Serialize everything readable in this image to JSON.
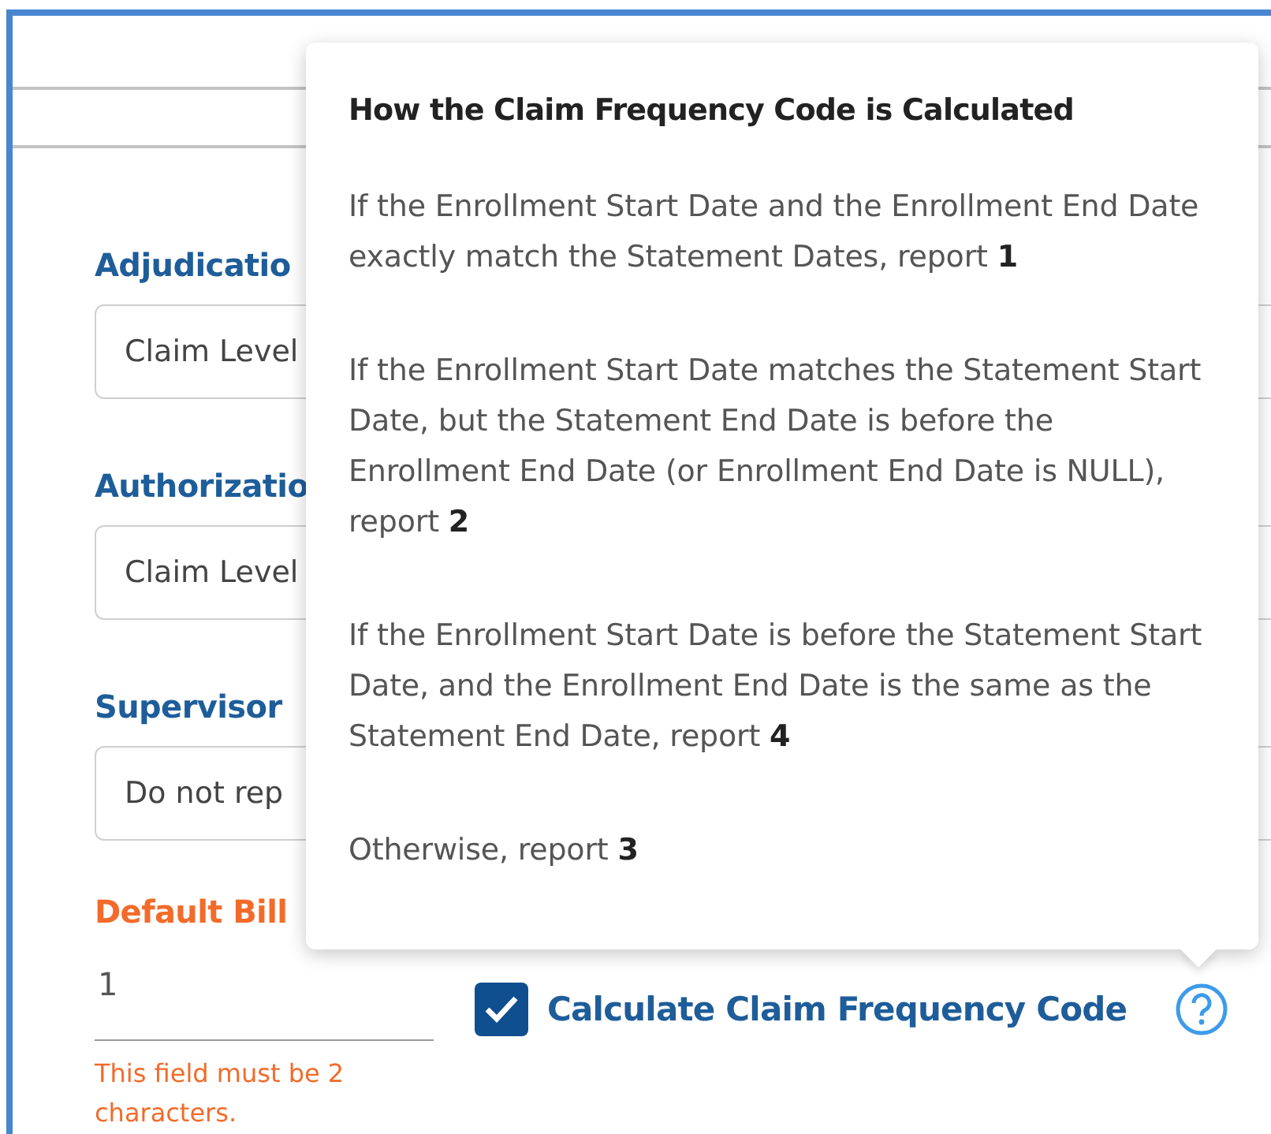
{
  "fields": [
    {
      "label": "Adjudicatio",
      "value": "Claim Level"
    },
    {
      "label": "Authorizatio",
      "value": "Claim Level"
    },
    {
      "label": "Supervisor",
      "value": "Do not rep"
    }
  ],
  "bill_field": {
    "label": "Default Bill",
    "value": "1",
    "error": "This field must be 2 characters.",
    "invalid": true
  },
  "checkbox": {
    "label": "Calculate Claim Frequency Code",
    "checked": true
  },
  "tooltip": {
    "title": "How the Claim Frequency Code is Calculated",
    "paragraphs": [
      "If the Enrollment Start Date and the Enrollment End Date exactly match the Statement Dates, report **1**",
      "If the Enrollment Start Date matches the Statement Start Date, but the Statement End Date is before the Enrollment End Date (or Enrollment End Date is NULL), report **2**",
      "If the Enrollment Start Date is before the Statement Start Date, and the Enrollment End Date is the same as the Statement End Date, report **4**",
      "Otherwise, report **3**"
    ]
  }
}
